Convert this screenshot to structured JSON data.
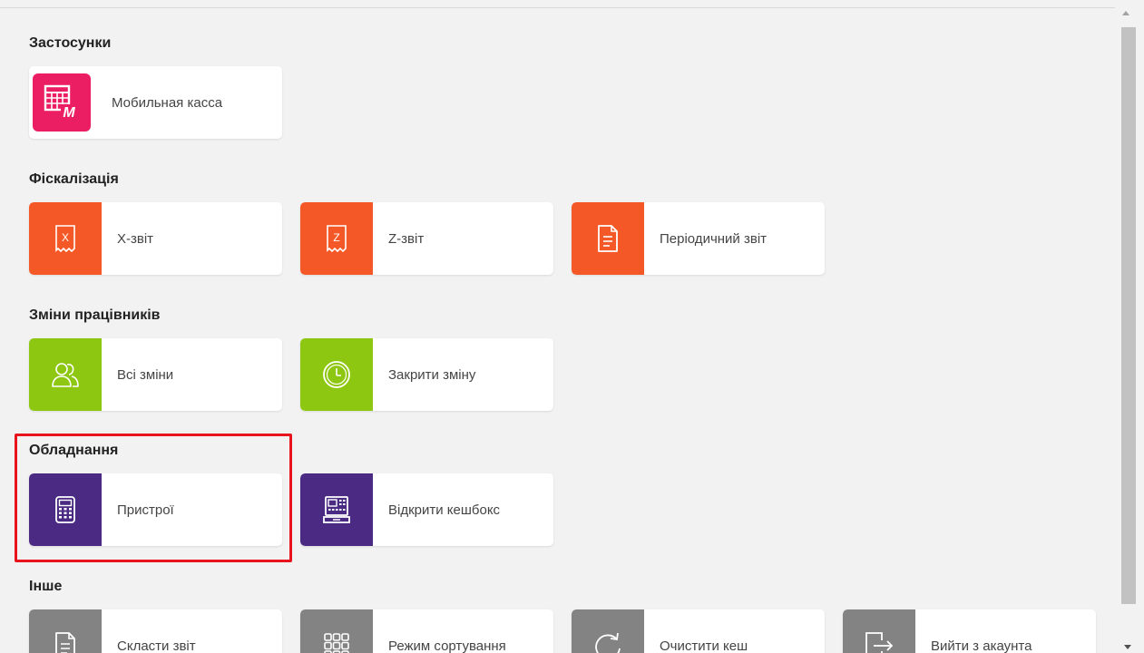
{
  "sections": {
    "apps": {
      "title": "Застосунки",
      "tiles": [
        {
          "label": "Мобильная касса",
          "icon": "mobile-cashbox-icon",
          "color": "#ec1e63"
        }
      ]
    },
    "fiscal": {
      "title": "Фіскалізація",
      "tiles": [
        {
          "label": "X-звіт",
          "icon": "x-report-icon",
          "glyph": "X",
          "color": "#f45826"
        },
        {
          "label": "Z-звіт",
          "icon": "z-report-icon",
          "glyph": "Z",
          "color": "#f45826"
        },
        {
          "label": "Періодичний звіт",
          "icon": "document-icon",
          "color": "#f45826"
        }
      ]
    },
    "shifts": {
      "title": "Зміни працівників",
      "tiles": [
        {
          "label": "Всі зміни",
          "icon": "users-icon",
          "color": "#8dc711"
        },
        {
          "label": "Закрити зміну",
          "icon": "clock-icon",
          "color": "#8dc711"
        }
      ]
    },
    "equipment": {
      "title": "Обладнання",
      "tiles": [
        {
          "label": "Пристрої",
          "icon": "calculator-icon",
          "color": "#4a2a82"
        },
        {
          "label": "Відкрити кешбокс",
          "icon": "cash-register-icon",
          "color": "#4a2a82"
        }
      ]
    },
    "other": {
      "title": "Інше",
      "tiles": [
        {
          "label": "Скласти звіт",
          "icon": "document-icon",
          "color": "#838383"
        },
        {
          "label": "Режим сортування",
          "icon": "grid-icon",
          "color": "#838383"
        },
        {
          "label": "Очистити кеш",
          "icon": "refresh-icon",
          "color": "#838383"
        },
        {
          "label": "Вийти з акаунта",
          "icon": "logout-icon",
          "color": "#838383"
        }
      ]
    }
  },
  "colors": {
    "highlight": "#e8131d",
    "background": "#f2f2f2"
  }
}
